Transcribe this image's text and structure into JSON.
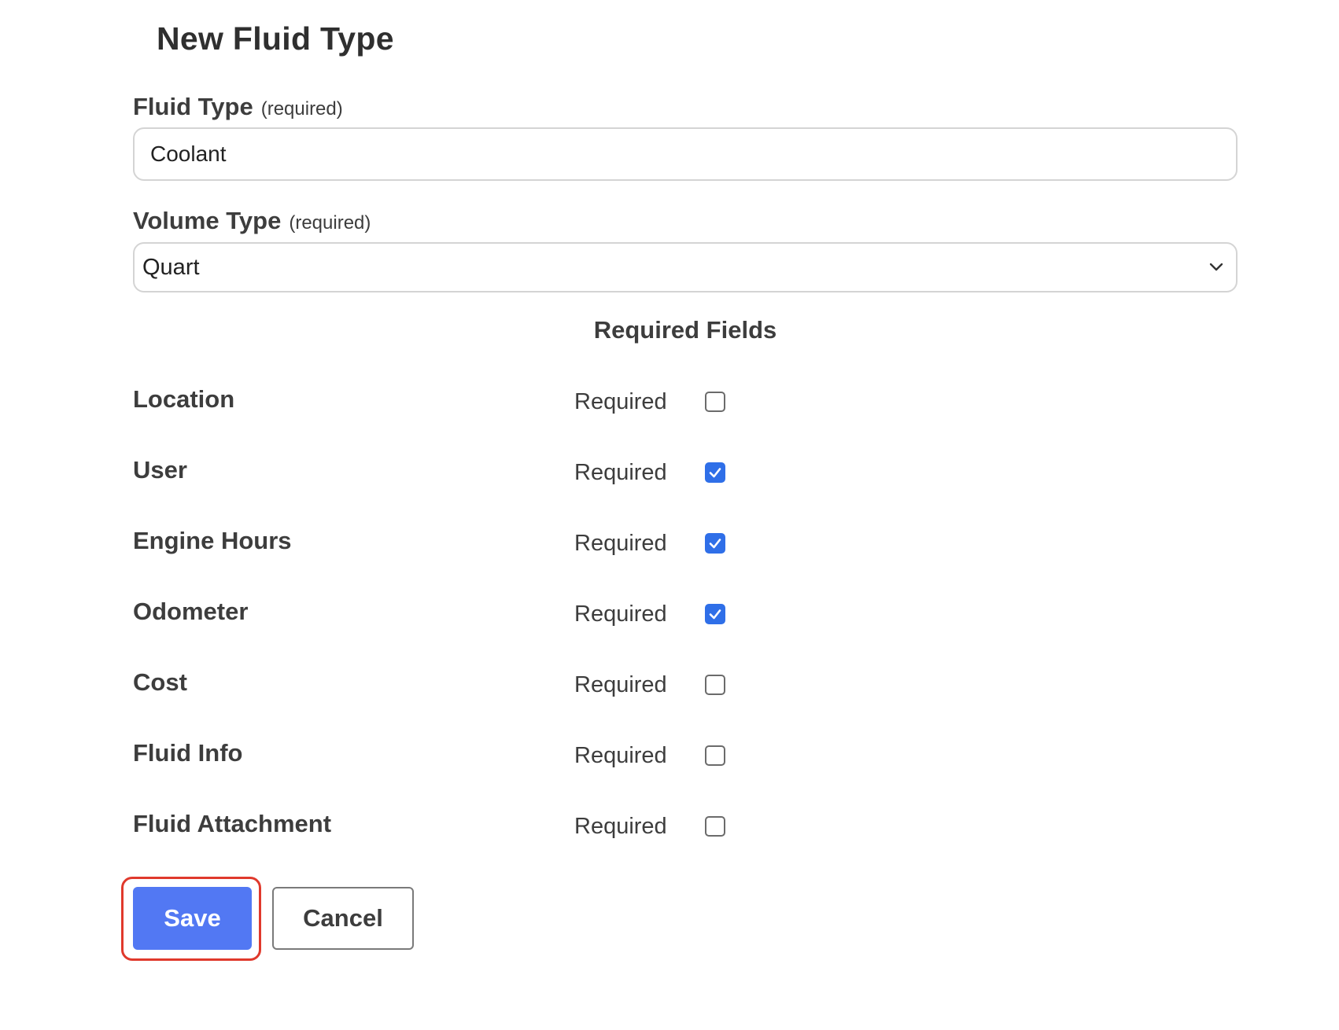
{
  "page": {
    "title": "New Fluid Type"
  },
  "fluid_type": {
    "label": "Fluid Type",
    "required_hint": "(required)",
    "value": "Coolant"
  },
  "volume_type": {
    "label": "Volume Type",
    "required_hint": "(required)",
    "selected": "Quart"
  },
  "required_fields": {
    "heading": "Required Fields",
    "rows": [
      {
        "label": "Location",
        "required_text": "Required",
        "checked": false
      },
      {
        "label": "User",
        "required_text": "Required",
        "checked": true
      },
      {
        "label": "Engine Hours",
        "required_text": "Required",
        "checked": true
      },
      {
        "label": "Odometer",
        "required_text": "Required",
        "checked": true
      },
      {
        "label": "Cost",
        "required_text": "Required",
        "checked": false
      },
      {
        "label": "Fluid Info",
        "required_text": "Required",
        "checked": false
      },
      {
        "label": "Fluid Attachment",
        "required_text": "Required",
        "checked": false
      }
    ]
  },
  "actions": {
    "save_label": "Save",
    "cancel_label": "Cancel"
  },
  "colors": {
    "accent": "#5278f3",
    "checkbox_checked": "#2f6fe8",
    "focus_ring": "#e0392c"
  }
}
